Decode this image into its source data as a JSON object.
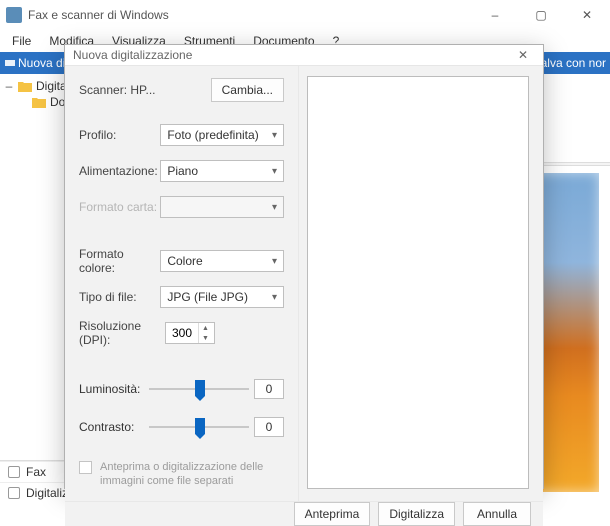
{
  "window": {
    "title": "Fax e scanner di Windows",
    "controls": {
      "minimize": "–",
      "maximize": "▢",
      "close": "✕"
    }
  },
  "menu": [
    "File",
    "Modifica",
    "Visualizza",
    "Strumenti",
    "Documento",
    "?"
  ],
  "toolbar": {
    "left_label": "Nuova digitaliz",
    "right_label": "Salva con nor"
  },
  "sidebar": {
    "items": [
      {
        "label": "Digitalizza",
        "expander": "–"
      },
      {
        "label": "Document",
        "expander": ""
      }
    ],
    "tabs": [
      "Fax",
      "Digitalizza"
    ]
  },
  "dialog": {
    "title": "Nuova digitalizzazione",
    "close": "✕",
    "scanner_label": "Scanner: HP...",
    "change_btn": "Cambia...",
    "profile_label": "Profilo:",
    "profile_value": "Foto (predefinita)",
    "source_label": "Alimentazione:",
    "source_value": "Piano",
    "paper_label": "Formato carta:",
    "paper_value": "",
    "color_label": "Formato colore:",
    "color_value": "Colore",
    "filetype_label": "Tipo di file:",
    "filetype_value": "JPG (File JPG)",
    "dpi_label": "Risoluzione (DPI):",
    "dpi_value": "300",
    "brightness_label": "Luminosità:",
    "brightness_value": "0",
    "contrast_label": "Contrasto:",
    "contrast_value": "0",
    "separate_label": "Anteprima o digitalizzazione delle immagini come file separati",
    "buttons": {
      "preview": "Anteprima",
      "scan": "Digitalizza",
      "cancel": "Annulla"
    }
  }
}
